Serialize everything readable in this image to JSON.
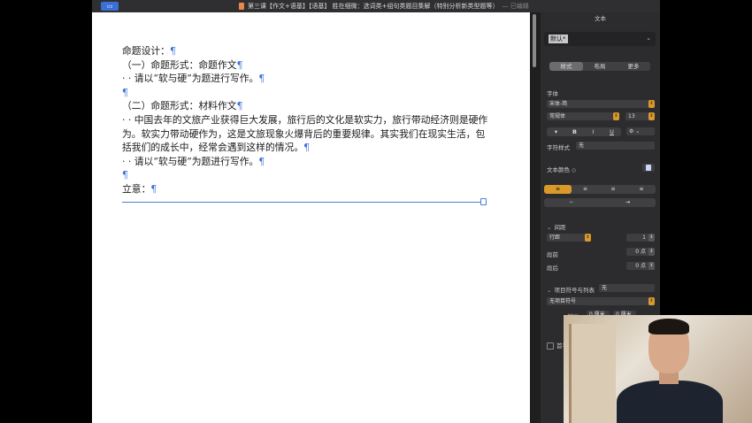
{
  "window": {
    "title": "第三课【作文+语基】【语基】 胜在细微：选词类+组句类题目集解（特别分析新类型题等）",
    "title_suffix": "— 已编辑",
    "sidebar_toggle_icon": "sidebar-icon"
  },
  "document": {
    "pilcrow": "¶",
    "paragraphs": [
      "命题设计：",
      "（一）命题形式：命题作文",
      "· · 请以“软与硬”为题进行写作。",
      "",
      "（二）命题形式：材料作文",
      "· · 中国去年的文旅产业获得巨大发展，旅行后的文化是软实力，旅行带动经济则是硬作为。软实力带动硬作为，这是文旅现象火爆背后的重要规律。其实我们在现实生活，包括我们的成长中，经常会遇到这样的情况。",
      "· · 请以“软与硬”为题进行写作。",
      "",
      "立意："
    ]
  },
  "inspector": {
    "header": "文本",
    "paragraph_style": "默认*",
    "tabs": [
      "样式",
      "布局",
      "更多"
    ],
    "selected_tab": "样式",
    "font_label": "字体",
    "font_family": "宋体-简",
    "font_style": "常规体",
    "font_size": "13",
    "format_buttons": [
      "▾",
      "B",
      "I",
      "U"
    ],
    "char_style_label": "字符样式",
    "char_style_value": "无",
    "text_color_label": "文本颜色 ◇",
    "alignment": [
      "≡",
      "≡",
      "≡",
      "≡"
    ],
    "indent": [
      "⇤",
      "⇥"
    ],
    "spacing_label": "间距",
    "line_spacing_mode": "行距",
    "line_spacing_value": "1",
    "before_label": "段前",
    "before_value": "0 点",
    "after_label": "段后",
    "after_value": "0 点",
    "bullets_label": "项目符号与列表",
    "bullets_value": "无",
    "bullet_style": "无项目符号",
    "indent_label": "缩进：",
    "indent_value_1": "0 厘米",
    "indent_value_2": "0 厘米",
    "drop_cap_label": "首字"
  }
}
